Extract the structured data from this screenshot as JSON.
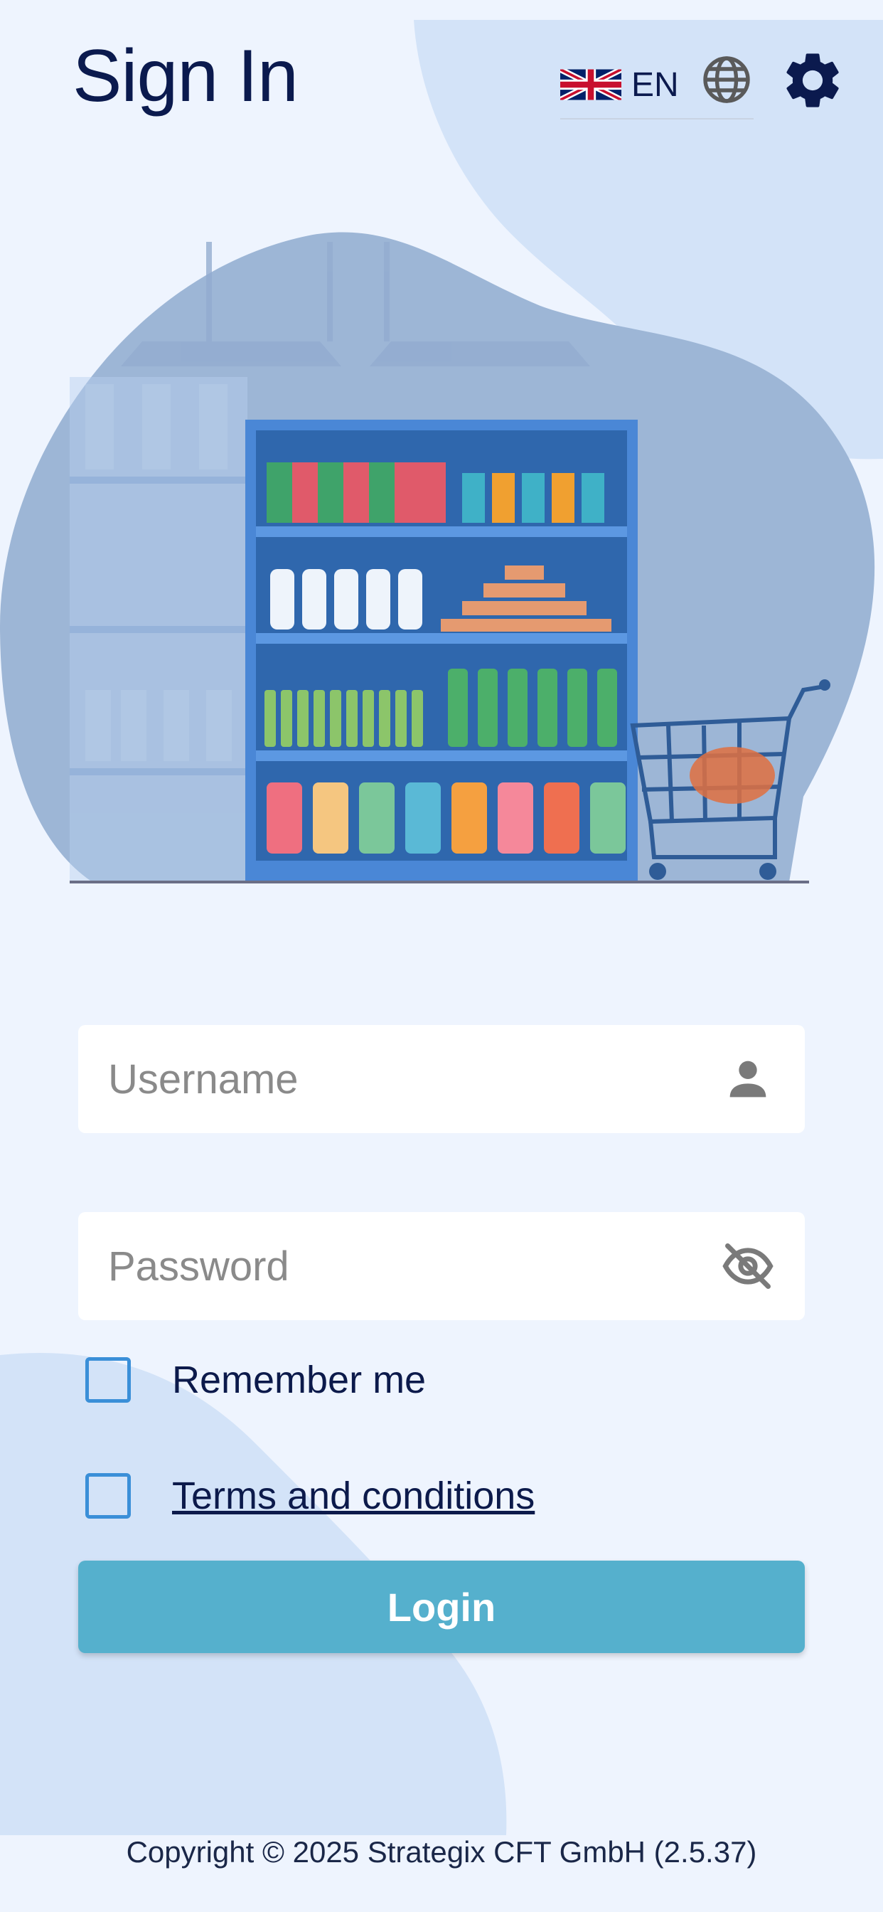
{
  "header": {
    "title": "Sign In",
    "language_code": "EN",
    "flag_icon": "uk-flag-icon",
    "globe_icon": "globe-icon",
    "settings_icon": "gear-icon"
  },
  "illustration": {
    "icon": "supermarket-shelf-illustration"
  },
  "form": {
    "username_placeholder": "Username",
    "username_value": "",
    "username_icon": "person-icon",
    "password_placeholder": "Password",
    "password_value": "",
    "password_icon": "eye-off-icon",
    "remember_label": "Remember me",
    "remember_checked": false,
    "terms_label": "Terms and conditions",
    "terms_checked": false,
    "login_label": "Login"
  },
  "footer": {
    "copyright": "Copyright © 2025 Strategix CFT GmbH (2.5.37)"
  },
  "colors": {
    "background": "#eef4fe",
    "blob": "#d3e3f8",
    "title": "#0b1a4e",
    "checkbox_border": "#3a8fd8",
    "login_button": "#55b0cd"
  }
}
